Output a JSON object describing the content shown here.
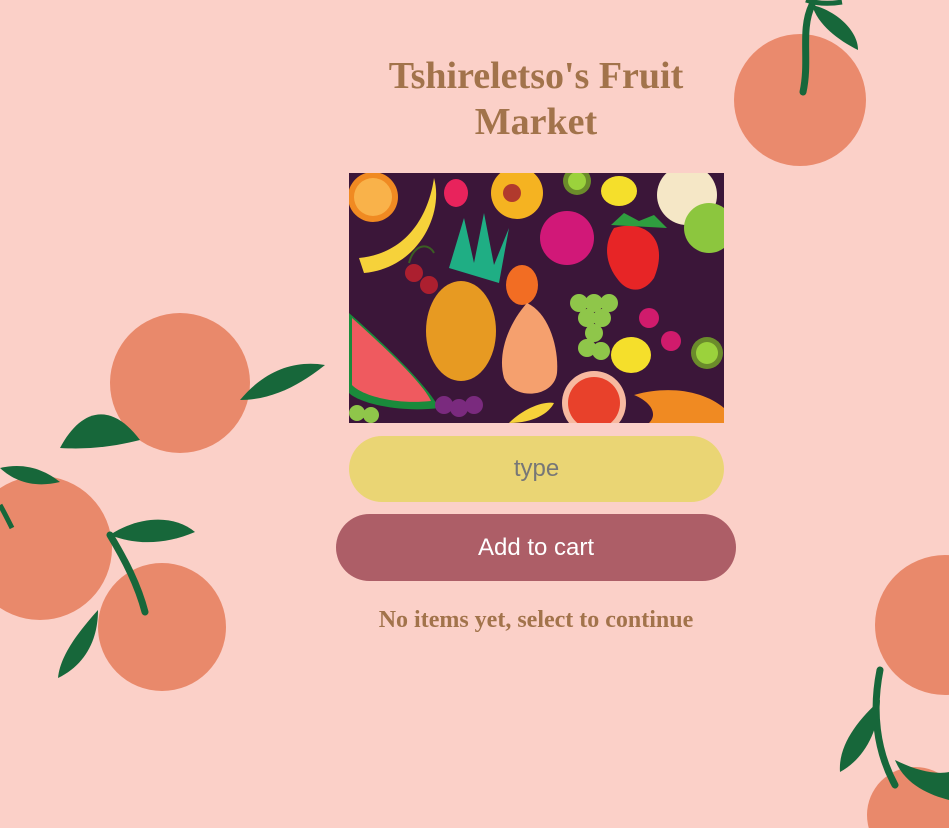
{
  "page": {
    "title": "Tshireletso's Fruit Market",
    "background_color": "#fbd0c8",
    "decorations": [
      "orange-fruit-icon",
      "leaf-icon"
    ]
  },
  "hero_image": {
    "description_icon": "assorted-fruit-illustration",
    "background_color": "#3b1639"
  },
  "form": {
    "input_value": "",
    "input_placeholder": "type",
    "input_color": "#ead574",
    "add_button_label": "Add to cart",
    "add_button_color": "#ad5e67"
  },
  "cart": {
    "status_text": "No items yet, select to continue"
  },
  "colors": {
    "title_text": "#a2734b",
    "orange": "#e98a6c",
    "leaf": "#17673a"
  }
}
